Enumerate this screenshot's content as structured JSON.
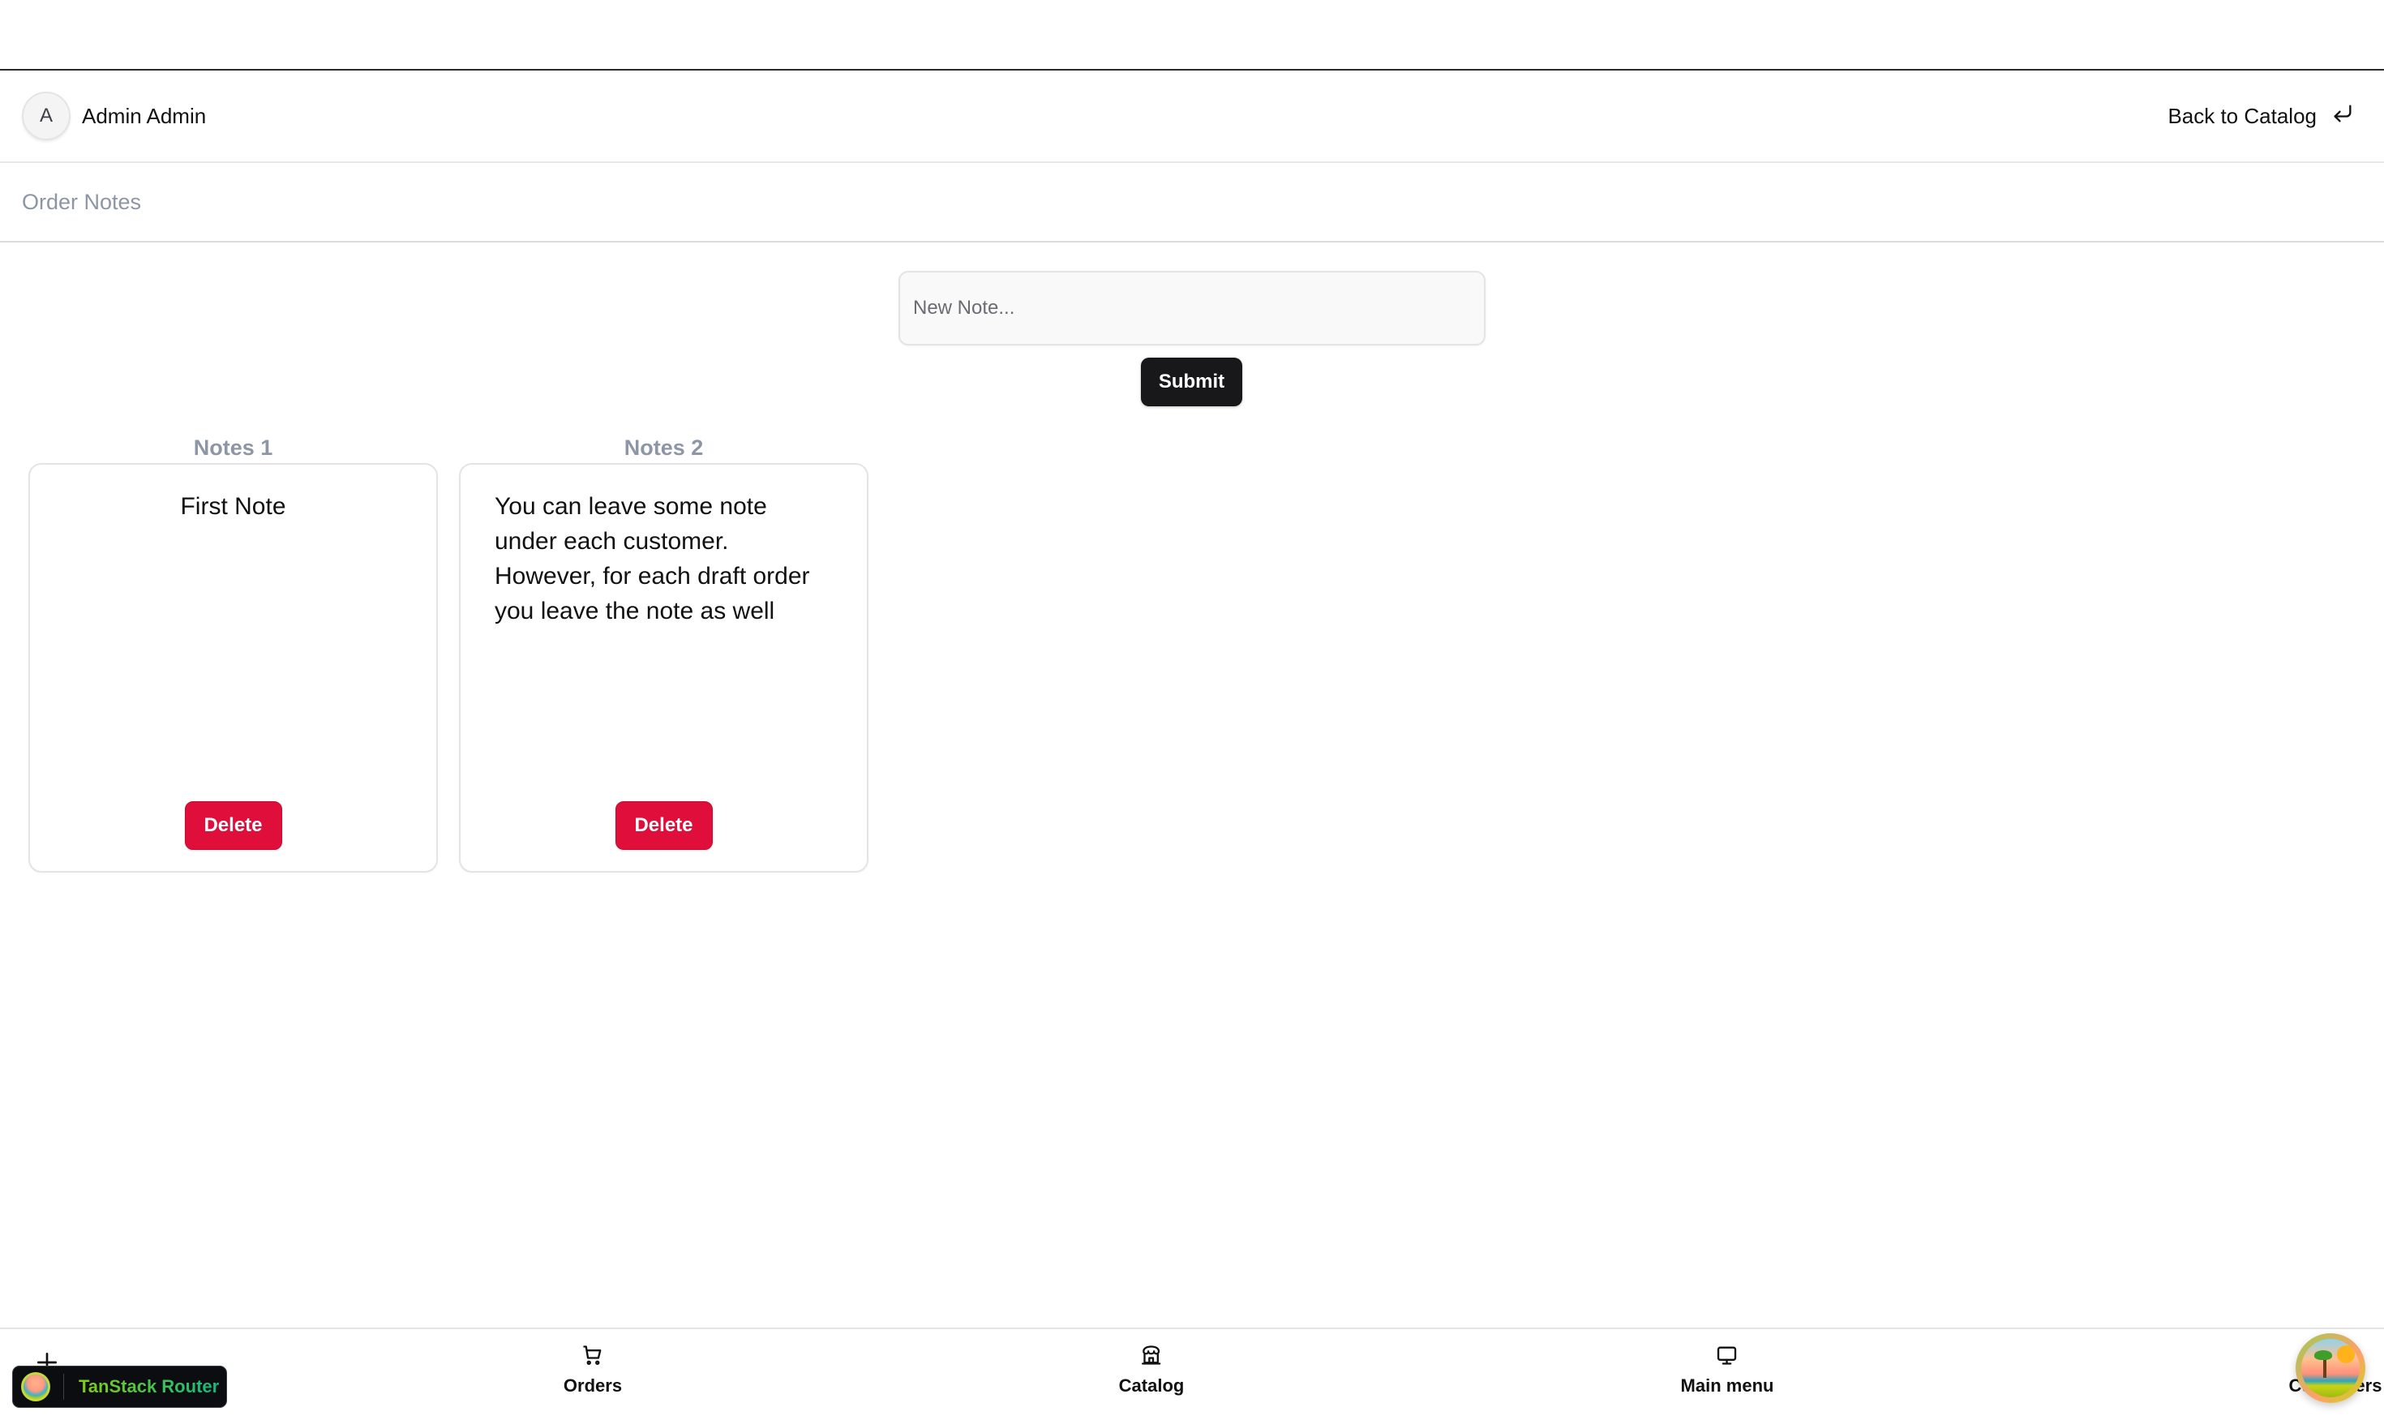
{
  "header": {
    "avatar_initial": "A",
    "user_name": "Admin Admin",
    "back_link_label": "Back to Catalog",
    "back_icon": "return-arrow-icon"
  },
  "page": {
    "title": "Order Notes"
  },
  "note_form": {
    "input_value": "",
    "input_placeholder": "New Note...",
    "submit_label": "Submit"
  },
  "notes": [
    {
      "label": "Notes 1",
      "text": "First Note",
      "delete_label": "Delete"
    },
    {
      "label": "Notes 2",
      "text": "You can leave some note under each customer. However, for each draft order you leave the note as well",
      "delete_label": "Delete"
    }
  ],
  "bottom_nav": {
    "add_icon": "plus-icon",
    "items": [
      {
        "label": "Orders",
        "icon": "cart-icon"
      },
      {
        "label": "Catalog",
        "icon": "store-icon"
      },
      {
        "label": "Main menu",
        "icon": "monitor-icon"
      },
      {
        "label": "Customers",
        "icon": "users-icon"
      }
    ]
  },
  "devtools": {
    "router_label": "TanStack Router"
  },
  "colors": {
    "delete": "#e00e3b",
    "submit": "#18181b",
    "muted_text": "#8d96a6"
  }
}
